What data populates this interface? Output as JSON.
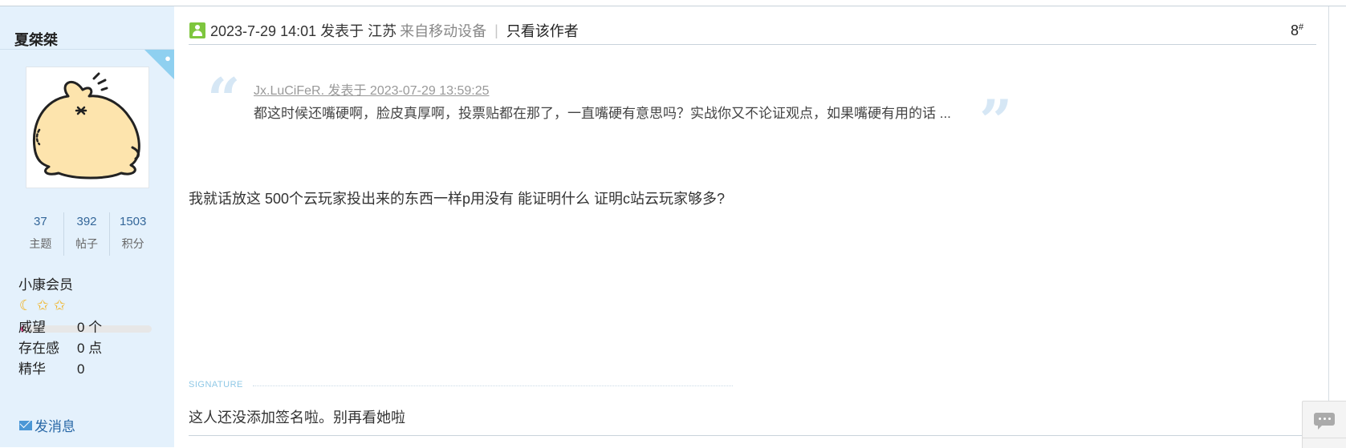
{
  "user": {
    "name": "夏桀桀",
    "stats": [
      {
        "num": "37",
        "label": "主题"
      },
      {
        "num": "392",
        "label": "帖子"
      },
      {
        "num": "1503",
        "label": "积分"
      }
    ],
    "grade": "小康会员",
    "medals": [
      "moon-icon",
      "star-icon",
      "star-icon"
    ],
    "exp_progress": 0.02,
    "profile": [
      {
        "key": "威望",
        "value": "0 个"
      },
      {
        "key": "存在感",
        "value": "0 点"
      },
      {
        "key": "精华",
        "value": "0"
      }
    ],
    "send_message": "发消息"
  },
  "post": {
    "time": "2023-7-29 14:01 发表于 江苏",
    "source": "来自移动设备",
    "separator": "|",
    "author_only": "只看该作者",
    "floor": "8",
    "floor_mark": "#",
    "quote": {
      "author_line": "Jx.LuCiFeR. 发表于 2023-07-29 13:59:25",
      "text": "都这时候还嘴硬啊，脸皮真厚啊，投票贴都在那了，一直嘴硬有意思吗？实战你又不论证观点，如果嘴硬有用的话 ..."
    },
    "content": "我就话放这 500个云玩家投出来的东西一样p用没有 能证明什么 证明c站云玩家够多?",
    "signature_label": "SIGNATURE",
    "signature": "这人还没添加签名啦。别再看她啦"
  },
  "colors": {
    "sidebar_bg": "#e4f1fc",
    "link": "#2767a6",
    "exp_fill": "#e6418a",
    "medal": "#f1b11f"
  }
}
